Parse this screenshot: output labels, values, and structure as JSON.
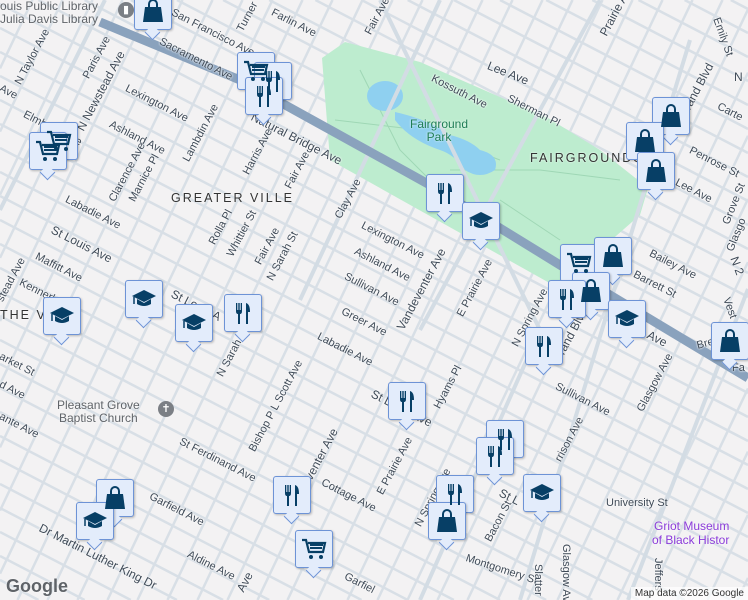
{
  "map": {
    "neighborhoods": [
      "GREATER VILLE",
      "FAIRGROUNDS",
      "THE V"
    ],
    "park_lines": [
      "Fairground",
      "Park"
    ],
    "pois": {
      "library_line1": "ouis Public Library",
      "library_line2": "Julia Davis Library",
      "church_line1": "Pleasant Grove",
      "church_line2": "Baptist Church",
      "museum_line1": "Griot Museum",
      "museum_line2": "of Black Histor"
    },
    "streets": {
      "natural_bridge": "Natural Bridge Ave",
      "san_francisco": "San Francisco Ave",
      "sacramento": "Sacramento Ave",
      "turner": "Turner",
      "farlin": "Farlin Ave",
      "fair_top": "Fair Ave",
      "n_taylor": "N Taylor Ave",
      "paris": "Paris Ave",
      "n_newstead": "N Newstead Ave",
      "lexington_w": "Lexington Ave",
      "elmbank": "Elmbank Ave",
      "ave_w": "Ave",
      "ashland_w": "Ashland Ave",
      "lambdin": "Lambdin Ave",
      "harris": "Harris Ave",
      "fair_mid": "Fair Ave",
      "clarence": "Clarence Ave",
      "marnice": "Marnice Pl",
      "labadie_w": "Labadie Ave",
      "st_louis_w": "St Louis Ave",
      "rolla": "Rolla Pl",
      "whittier": "Whittier St",
      "fair_low": "Fair Ave",
      "n_sarah": "N Sarah St",
      "clay": "Clay Ave",
      "lexington_e": "Lexington Ave",
      "ashland_e": "Ashland Ave",
      "sullivan_w": "Sullivan Ave",
      "greer": "Greer Ave",
      "labadie_e": "Labadie Ave",
      "vandeventer": "Vandeventer Ave",
      "newstead_sw": "stead Ave",
      "maffitt": "Maffitt Ave",
      "kennerly": "Kennerly A",
      "arket": "arket St",
      "ave_sw": "d Ave",
      "ante": "ante Ave",
      "st_louis_mid": "St Louis A",
      "n_sarah_low": "N Sarah St",
      "bishop": "Bishop P L Scott Ave",
      "st_ferdinand": "St Ferdinand Ave",
      "garfield": "Garfield Ave",
      "vandeventer_low": "eventer Ave",
      "cottage": "Cottage Ave",
      "mlk": "Dr Martin Luther King Dr",
      "aldine": "Aldine Ave",
      "garfield_low": "Garfiel",
      "ave_low": "Ave",
      "e_prairie_low": "E Prairie Ave",
      "n_spring_low": "N Spring Ave",
      "st_louis_e": "St Louis Ave",
      "hyams": "Hyams Pl",
      "st_louis_e2": "St L",
      "e_prairie": "E Prairie Ave",
      "n_spring": "N Spring Ave",
      "grand": "Grand Blvd",
      "sullivan_e": "Sullivan Ave",
      "glasgow": "Glasgow Ave",
      "harrison": "rrison Ave",
      "bacon": "Bacon St",
      "montgomery": "Montgomery St",
      "slattery": "Slatter",
      "glasgow_low": "Glasgow Av",
      "university": "University St",
      "jefferson": "Jeffers",
      "lee_top": "Lee Ave",
      "prairie": "Prairie Ave",
      "emily": "Emily St",
      "kossuth": "Kossuth Ave",
      "sherman": "Sherman Pl",
      "grand_top": "Grand Blvd",
      "carter": "Carte",
      "n_top": "N",
      "penrose": "Penrose St",
      "lee_e": "Lee Ave",
      "grove": "Grove St",
      "glasgow_top": "Glasgo",
      "bailey": "Bailey Ave",
      "barrett": "Barrett St",
      "vest": "Vest",
      "bremen": "Breme",
      "fa": "Fa",
      "ave_e": "Ave",
      "n2": "N 2"
    },
    "markers": [
      {
        "type": "shopping"
      },
      {
        "type": "grocery"
      },
      {
        "type": "restaurant"
      },
      {
        "type": "restaurant"
      },
      {
        "type": "grocery"
      },
      {
        "type": "grocery"
      },
      {
        "type": "restaurant"
      },
      {
        "type": "school"
      },
      {
        "type": "shopping"
      },
      {
        "type": "shopping"
      },
      {
        "type": "shopping"
      },
      {
        "type": "grocery"
      },
      {
        "type": "shopping"
      },
      {
        "type": "shopping"
      },
      {
        "type": "restaurant"
      },
      {
        "type": "school"
      },
      {
        "type": "shopping"
      },
      {
        "type": "school"
      },
      {
        "type": "school"
      },
      {
        "type": "school"
      },
      {
        "type": "restaurant"
      },
      {
        "type": "restaurant"
      },
      {
        "type": "restaurant"
      },
      {
        "type": "restaurant"
      },
      {
        "type": "restaurant"
      },
      {
        "type": "school"
      },
      {
        "type": "restaurant"
      },
      {
        "type": "shopping"
      },
      {
        "type": "shopping"
      },
      {
        "type": "school"
      },
      {
        "type": "restaurant"
      },
      {
        "type": "grocery"
      }
    ],
    "colors": {
      "land": "#f3f2f3",
      "road": "#d3dce4",
      "highway": "#8aa2bd",
      "park": "#bdeccf",
      "water": "#8fd0f0",
      "marker_icon": "#073f66"
    }
  },
  "footer": {
    "logo": "Google",
    "attribution": "Map data ©2026 Google"
  }
}
